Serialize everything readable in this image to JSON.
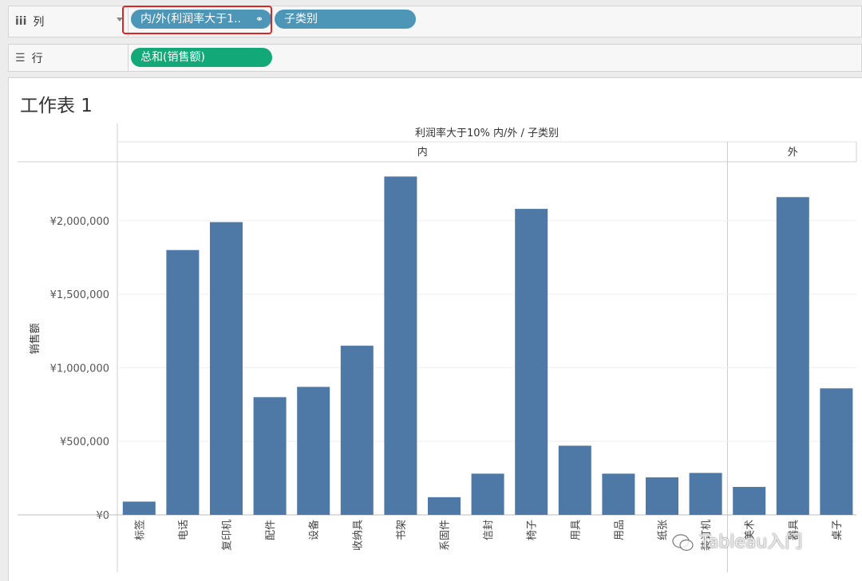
{
  "shelves": {
    "columns": {
      "label": "列",
      "pills": [
        "内/外(利润率大于1..",
        "子类别"
      ]
    },
    "rows": {
      "label": "行",
      "pills": [
        "总和(销售额)"
      ]
    }
  },
  "sheet_title": "工作表 1",
  "watermark": "Tableau入门",
  "colors": {
    "bar": "#4e79a7",
    "pill_blue": "#4d96b8",
    "pill_green": "#13a877",
    "highlight": "#e02424"
  },
  "icons": {
    "columns_shelf": "columns-icon",
    "rows_shelf": "rows-icon",
    "pill_link": "link-icon",
    "watermark": "wechat-icon"
  },
  "chart_data": {
    "type": "bar",
    "header_title": "利润率大于10% 内/外 / 子类别",
    "ylabel": "销售额",
    "ylim": [
      0,
      2400000
    ],
    "yticks": [
      0,
      500000,
      1000000,
      1500000,
      2000000
    ],
    "ytick_labels": [
      "¥0",
      "¥500,000",
      "¥1,000,000",
      "¥1,500,000",
      "¥2,000,000"
    ],
    "groups": [
      {
        "name": "内",
        "categories": [
          "标签",
          "电话",
          "复印机",
          "配件",
          "设备",
          "收纳具",
          "书架",
          "系固件",
          "信封",
          "椅子",
          "用具",
          "用品",
          "纸张",
          "装订机"
        ],
        "values": [
          90000,
          1800000,
          1990000,
          800000,
          870000,
          1150000,
          2300000,
          120000,
          280000,
          2080000,
          470000,
          280000,
          255000,
          285000
        ]
      },
      {
        "name": "外",
        "categories": [
          "美术",
          "器具",
          "桌子"
        ],
        "values": [
          190000,
          2160000,
          860000
        ]
      }
    ]
  }
}
